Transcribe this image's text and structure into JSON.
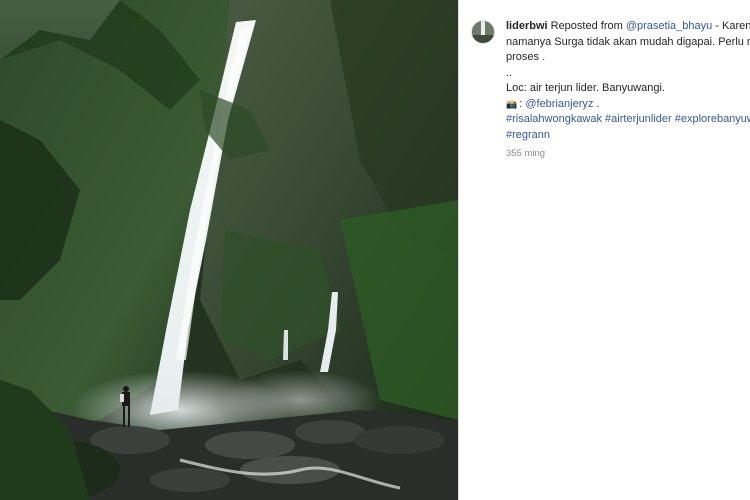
{
  "post": {
    "username": "liderbwi",
    "reposted_label": "Reposted from",
    "reposted_handle": "@prasetia_bhayu",
    "caption_line1_tail": " - Karena ya",
    "caption_line2": "namanya Surga tidak akan mudah digapai. Perlu melew",
    "caption_line3": "proses .",
    "caption_dots": "..",
    "location": "Loc: air terjun lider. Banyuwangi.",
    "camera_icon": "camera-icon",
    "credit_prefix": ": ",
    "credit_handle": "@febrianjeryz",
    "credit_suffix": " .",
    "hashtags_line1": "#risalahwongkawak #airterjunlider #explorebanyuwan",
    "hashtags_line2": "#regrann",
    "timestamp": "355 ming"
  },
  "colors": {
    "link": "#385898",
    "text": "#262626",
    "muted": "#8e8e8e",
    "border": "#dbdbdb"
  }
}
